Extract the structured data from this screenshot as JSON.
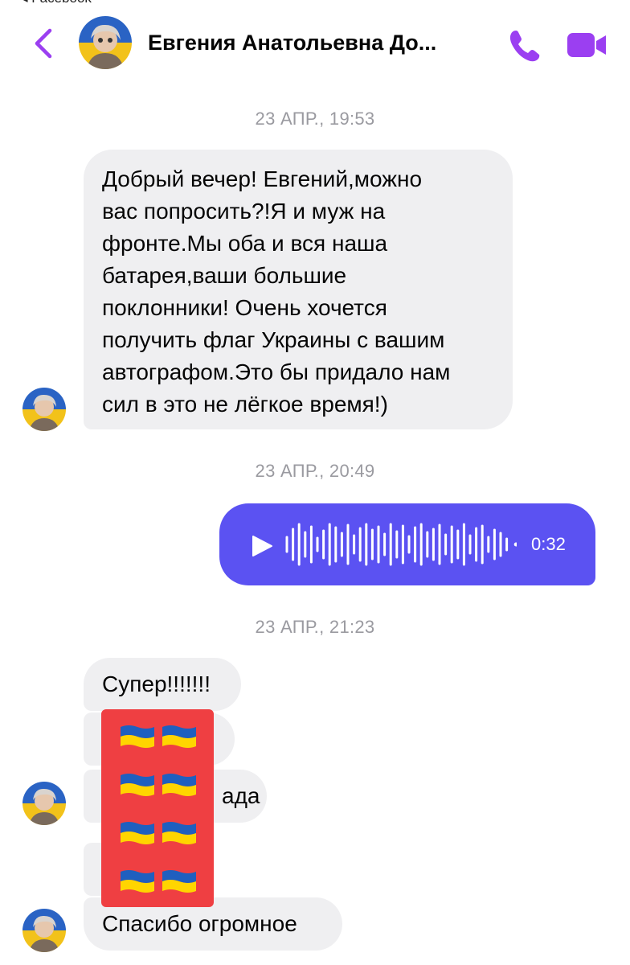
{
  "header": {
    "back_caption": "◂ Facebook",
    "contact_name": "Евгения Анатольевна До...",
    "icons": {
      "back": "chevron-left-icon",
      "call": "phone-icon",
      "video": "video-camera-icon"
    },
    "accent_color": "#9b3ff1"
  },
  "messages": {
    "timestamp_1": "23 АПР., 19:53",
    "message_1_lines": [
      "Добрый вечер! Евгений,можно",
      "вас попросить?!Я и муж на",
      "фронте.Мы оба и вся наша",
      "батарея,ваши большие",
      "поклонники! Очень хочется",
      "получить флаг Украины с вашим",
      "автографом.Это бы придало нам",
      "сил в это не лёгкое время!)"
    ],
    "timestamp_2": "23 АПР., 20:49",
    "voice_message": {
      "duration": "0:32",
      "color": "#5b52f2"
    },
    "timestamp_3": "23 АПР., 21:23",
    "reply_1": "Супер!!!!!!!",
    "reply_3_visible": "ада",
    "reply_5": "Спасибо огромное",
    "redaction": {
      "color": "#ef3f42",
      "emoji": "ukraine-flag-emoji",
      "flag_colors": [
        "#1f5fbf",
        "#ffd500"
      ]
    }
  }
}
